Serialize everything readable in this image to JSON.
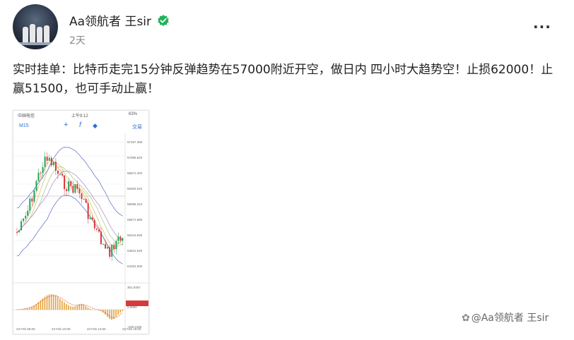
{
  "author": {
    "name": "Aa领航者 王sir",
    "time": "2天"
  },
  "post": {
    "text": "实时挂单：比特币走完15分钟反弹趋势在57000附近开空，做日内 四小时大趋势空！止损62000！止赢51500，也可手动止赢！"
  },
  "more_icon": "···",
  "screenshot": {
    "status_carrier": "中国电信",
    "status_time": "上午9:12",
    "status_battery": "63%",
    "toolbar_left": "M15",
    "toolbar_right": "交易",
    "price_labels": [
      "57157.380",
      "57095.620",
      "56671.302",
      "56263.010",
      "56096.310",
      "55671.880",
      "55416.825",
      "54841.520",
      "54252.000"
    ],
    "macd_labels": [
      "351.0467",
      "0.0000",
      "-106.2180"
    ],
    "dates": [
      "23 Feb 06:00",
      "23 Feb 10:00",
      "23 Feb 14:00",
      "23 Feb 19:00"
    ]
  },
  "watermark": {
    "icon": "✿",
    "text": "@Aa领航者 王sir"
  },
  "colors": {
    "bull": "#1ea356",
    "bear": "#d9383a",
    "badge": "#20b25a",
    "link": "#2f6fd1"
  }
}
